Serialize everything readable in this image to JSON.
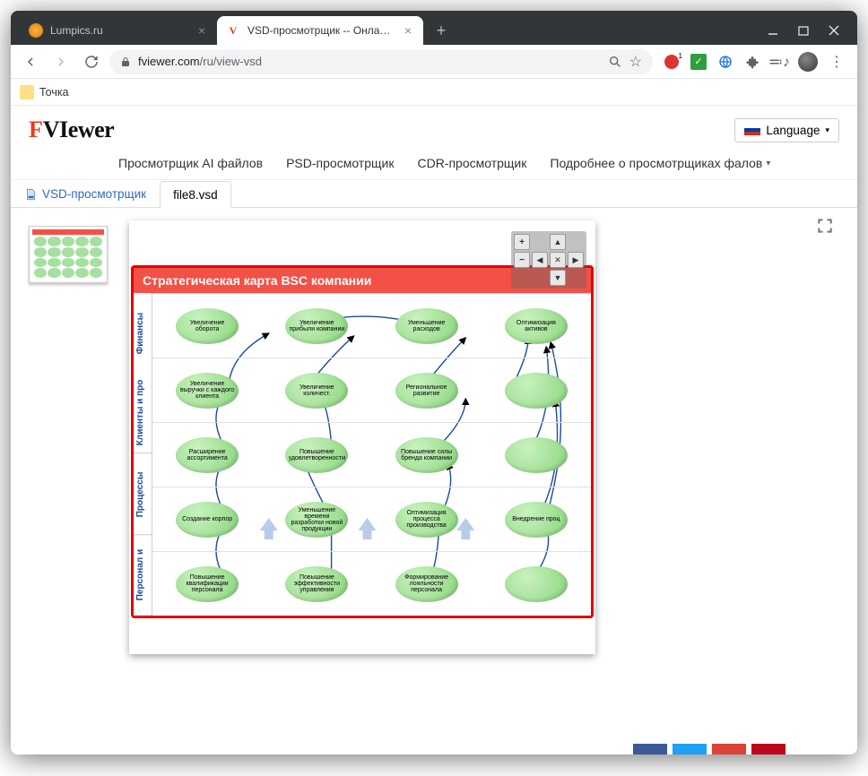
{
  "browser": {
    "tabs": [
      {
        "title": "Lumpics.ru",
        "active": false
      },
      {
        "title": "VSD-просмотрщик -- Онлайн п…",
        "active": true
      }
    ],
    "url_host": "fviewer.com",
    "url_path": "/ru/view-vsd",
    "bookmark": "Точка"
  },
  "site": {
    "lang_label": "Language",
    "nav": {
      "ai": "Просмотрщик AI файлов",
      "psd": "PSD-просмотрщик",
      "cdr": "CDR-просмотрщик",
      "more": "Подробнее о просмотрщиках фалов"
    },
    "file_tabs": {
      "viewer": "VSD-просмотрщик",
      "filename": "file8.vsd"
    }
  },
  "zoom": {
    "plus": "+",
    "minus": "−",
    "center": "✕",
    "up": "▲",
    "down": "▼",
    "left": "◀",
    "right": "▶"
  },
  "doc": {
    "title": "Стратегическая карта BSC компании",
    "sidelabels": {
      "fin": "Финансы",
      "cli": "Клиенты и про",
      "proc": "Процессы",
      "pers": "Персонал и"
    },
    "rows": [
      [
        "Увеличение оборота",
        "Увеличение прибыли компании",
        "Уменьшение расходов",
        "Оптимизация активов"
      ],
      [
        "Увеличение выручки с каждого клиента",
        "Увеличение количест.",
        "Региональное развитие",
        ""
      ],
      [
        "Расширение ассортимента",
        "Повышение удовлетворенности",
        "Повышение силы бренда компании",
        ""
      ],
      [
        "Создание корпор",
        "Уменьшение времени разработки новой продукции",
        "Оптимизация процесса производства",
        "Внедрение проц"
      ],
      [
        "Повышение квалификации персонала",
        "Повышение эффективности управления",
        "Формирование лояльности персонала",
        ""
      ]
    ]
  }
}
